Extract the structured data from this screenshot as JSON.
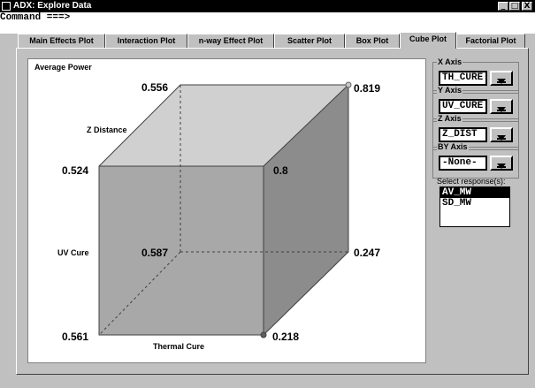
{
  "window": {
    "title": "ADX: Explore Data",
    "minimize": "_",
    "maximize": "□",
    "close": "X"
  },
  "command": {
    "text": "Command ===>"
  },
  "tabs": [
    {
      "label": "Main Effects Plot",
      "active": false
    },
    {
      "label": "Interaction Plot",
      "active": false
    },
    {
      "label": "n-way Effect Plot",
      "active": false
    },
    {
      "label": "Scatter Plot",
      "active": false
    },
    {
      "label": "Box Plot",
      "active": false
    },
    {
      "label": "Cube Plot",
      "active": true
    },
    {
      "label": "Factorial Plot",
      "active": false
    }
  ],
  "plot": {
    "title": "Average Power",
    "axis_labels": {
      "z": "Z Distance",
      "y": "UV Cure",
      "x": "Thermal Cure"
    },
    "corners": {
      "back_top_left": "0.556",
      "back_top_right": "0.819",
      "front_top_left": "0.524",
      "front_top_right": "0.8",
      "back_bottom_left": "0.587",
      "back_bottom_right": "0.247",
      "front_bottom_left": "0.561",
      "front_bottom_right": "0.218"
    },
    "colors": {
      "top_face": "#d0d0d0",
      "front_face": "#a8a8a8",
      "right_face": "#8c8c8c",
      "edge": "#404040"
    }
  },
  "axes_panel": {
    "x_axis": {
      "label": "X Axis",
      "value": "TH_CURE"
    },
    "y_axis": {
      "label": "Y Axis",
      "value": "UV_CURE"
    },
    "z_axis": {
      "label": "Z Axis",
      "value": "Z_DIST"
    },
    "by_axis": {
      "label": "BY Axis",
      "value": "-None-"
    }
  },
  "responses": {
    "label": "Select response(s):",
    "items": [
      {
        "label": "AV_MW",
        "selected": true
      },
      {
        "label": "SD_MW",
        "selected": false
      }
    ]
  }
}
